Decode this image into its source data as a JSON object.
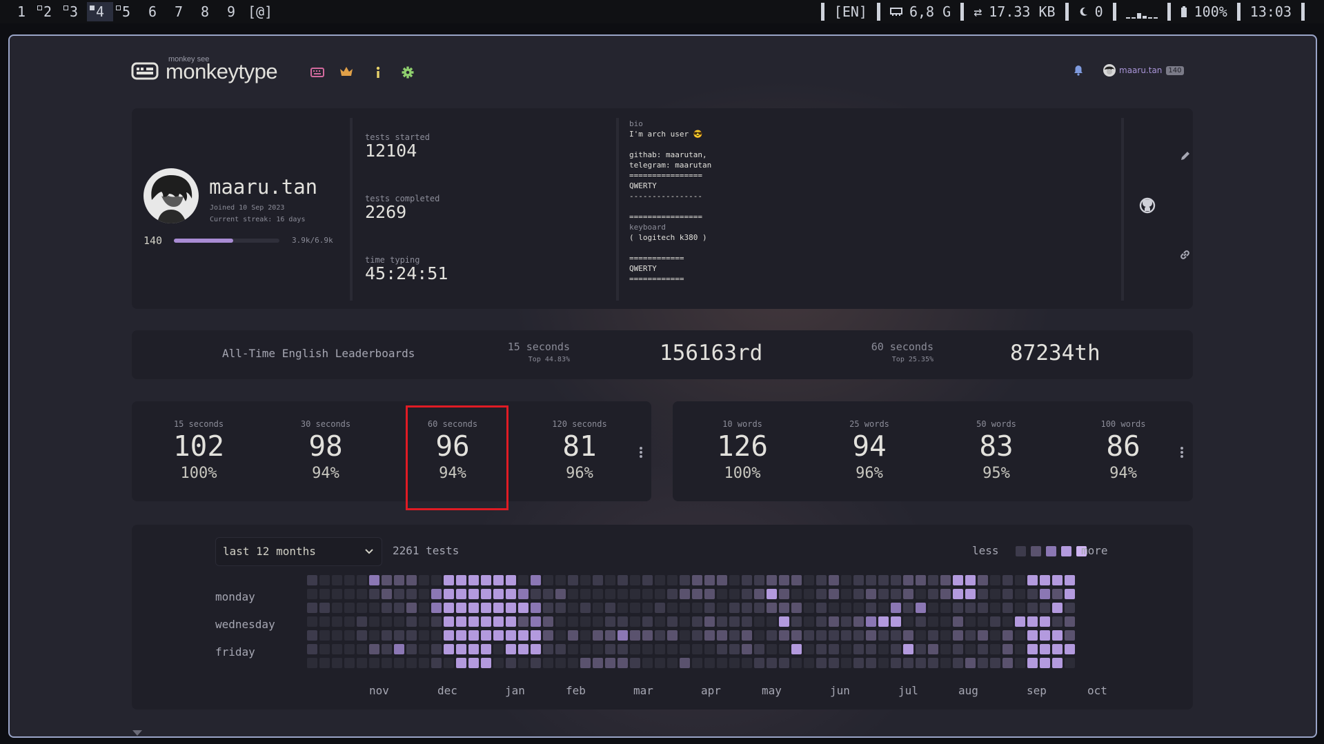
{
  "topbar": {
    "workspaces": [
      {
        "label": "1",
        "occupied": false,
        "active": false
      },
      {
        "label": "2",
        "occupied": true,
        "active": false
      },
      {
        "label": "3",
        "occupied": true,
        "active": false
      },
      {
        "label": "4",
        "occupied": true,
        "active": true
      },
      {
        "label": "5",
        "occupied": true,
        "active": false
      },
      {
        "label": "6",
        "occupied": false,
        "active": false
      },
      {
        "label": "7",
        "occupied": false,
        "active": false
      },
      {
        "label": "8",
        "occupied": false,
        "active": false
      },
      {
        "label": "9",
        "occupied": false,
        "active": false
      },
      {
        "label": "[@]",
        "occupied": false,
        "active": false
      }
    ],
    "layout": "[EN]",
    "memory": "6,8 G",
    "network": "17.33 KB",
    "notifications": "0",
    "battery": "100%",
    "clock": "13:03"
  },
  "header": {
    "logo_top": "monkey see",
    "logo_text": "monkeytype",
    "nav_icons": [
      "keyboard-icon",
      "crown-icon",
      "info-icon",
      "gear-icon"
    ],
    "username": "maaru.tan",
    "level": "140"
  },
  "profile": {
    "name": "maaru.tan",
    "joined": "Joined 10 Sep 2023",
    "streak": "Current streak: 16 days",
    "level": "140",
    "xp": "3.9k/6.9k",
    "xp_progress": 0.565,
    "stats": [
      {
        "label": "tests started",
        "value": "12104"
      },
      {
        "label": "tests completed",
        "value": "2269"
      },
      {
        "label": "time typing",
        "value": "45:24:51"
      }
    ],
    "bio_label": "bio",
    "bio": "I'm arch user 😎\n\ngithab: maarutan,\ntelegram: maarutan\n================\nQWERTY\n----------------\n\n================",
    "keyboard_label": "keyboard",
    "keyboard": "( logitech k380 )\n\n============\nQWERTY\n============"
  },
  "leaderboards": {
    "title": "All-Time English Leaderboards",
    "entries": [
      {
        "mode": "15 seconds",
        "top": "Top 44.83%",
        "rank": "156163rd"
      },
      {
        "mode": "60 seconds",
        "top": "Top 25.35%",
        "rank": "87234th"
      }
    ]
  },
  "time_pbs": [
    {
      "mode": "15 seconds",
      "wpm": "102",
      "acc": "100%"
    },
    {
      "mode": "30 seconds",
      "wpm": "98",
      "acc": "94%"
    },
    {
      "mode": "60 seconds",
      "wpm": "96",
      "acc": "94%"
    },
    {
      "mode": "120 seconds",
      "wpm": "81",
      "acc": "96%"
    }
  ],
  "word_pbs": [
    {
      "mode": "10 words",
      "wpm": "126",
      "acc": "100%"
    },
    {
      "mode": "25 words",
      "wpm": "94",
      "acc": "96%"
    },
    {
      "mode": "50 words",
      "wpm": "83",
      "acc": "95%"
    },
    {
      "mode": "100 words",
      "wpm": "86",
      "acc": "94%"
    }
  ],
  "activity": {
    "range": "last 12 months",
    "total": "2261 tests",
    "less": "less",
    "more": "more",
    "days": [
      "monday",
      "wednesday",
      "friday"
    ],
    "months": [
      "nov",
      "dec",
      "jan",
      "feb",
      "mar",
      "apr",
      "may",
      "jun",
      "jul",
      "aug",
      "sep",
      "oct"
    ],
    "colors": [
      "#2c2c37",
      "#3d3b4c",
      "#5a526e",
      "#8b77b4",
      "#b39ade",
      "#cfb4f2"
    ],
    "grid": [
      [
        1,
        0,
        0,
        0,
        0,
        3,
        2,
        2,
        2,
        0,
        0,
        4,
        4,
        4,
        4,
        4,
        4,
        0,
        3,
        0,
        0,
        1,
        0,
        1,
        0,
        1,
        0,
        1,
        0,
        0,
        1,
        2,
        2,
        2,
        0,
        1,
        1,
        2,
        2,
        2,
        0,
        1,
        2,
        0,
        1,
        1,
        1,
        1,
        2,
        2,
        1,
        2,
        4,
        4,
        2,
        0,
        1,
        0,
        4,
        4,
        4,
        4
      ],
      [
        0,
        0,
        0,
        0,
        0,
        1,
        2,
        1,
        1,
        0,
        3,
        4,
        4,
        4,
        4,
        4,
        4,
        3,
        1,
        1,
        2,
        0,
        0,
        0,
        0,
        0,
        0,
        0,
        0,
        1,
        2,
        2,
        2,
        0,
        0,
        1,
        2,
        4,
        2,
        0,
        0,
        1,
        2,
        0,
        1,
        2,
        1,
        1,
        2,
        0,
        1,
        2,
        4,
        4,
        1,
        0,
        1,
        0,
        1,
        3,
        2,
        4
      ],
      [
        1,
        1,
        0,
        0,
        0,
        0,
        1,
        1,
        2,
        0,
        3,
        4,
        4,
        4,
        4,
        4,
        4,
        4,
        3,
        1,
        1,
        0,
        1,
        0,
        1,
        0,
        0,
        0,
        1,
        0,
        0,
        0,
        1,
        0,
        1,
        1,
        1,
        2,
        2,
        2,
        0,
        1,
        0,
        0,
        0,
        1,
        0,
        3,
        1,
        3,
        0,
        0,
        1,
        1,
        1,
        0,
        1,
        0,
        1,
        1,
        4,
        1
      ],
      [
        0,
        0,
        0,
        0,
        1,
        0,
        0,
        0,
        1,
        0,
        1,
        4,
        4,
        4,
        4,
        4,
        4,
        2,
        3,
        2,
        0,
        0,
        0,
        0,
        1,
        1,
        0,
        1,
        0,
        1,
        0,
        1,
        2,
        1,
        1,
        1,
        0,
        0,
        4,
        1,
        0,
        1,
        2,
        1,
        2,
        3,
        4,
        4,
        0,
        1,
        0,
        0,
        2,
        0,
        0,
        1,
        0,
        4,
        4,
        4,
        1,
        2
      ],
      [
        1,
        0,
        0,
        0,
        1,
        0,
        1,
        1,
        1,
        0,
        0,
        4,
        4,
        4,
        4,
        4,
        4,
        4,
        4,
        2,
        0,
        2,
        0,
        2,
        2,
        3,
        2,
        2,
        1,
        2,
        0,
        1,
        2,
        2,
        1,
        2,
        0,
        1,
        2,
        2,
        1,
        1,
        1,
        1,
        1,
        2,
        1,
        1,
        2,
        0,
        1,
        0,
        2,
        1,
        2,
        0,
        2,
        0,
        4,
        4,
        4,
        2
      ],
      [
        1,
        0,
        0,
        0,
        0,
        2,
        1,
        3,
        1,
        0,
        1,
        4,
        4,
        4,
        4,
        0,
        4,
        4,
        4,
        1,
        1,
        0,
        0,
        0,
        1,
        1,
        0,
        0,
        0,
        0,
        0,
        0,
        0,
        1,
        1,
        2,
        1,
        0,
        0,
        4,
        0,
        1,
        1,
        0,
        1,
        1,
        0,
        1,
        4,
        1,
        2,
        0,
        1,
        0,
        1,
        0,
        2,
        0,
        4,
        4,
        4,
        4
      ],
      [
        0,
        0,
        0,
        0,
        0,
        0,
        0,
        0,
        0,
        0,
        1,
        0,
        4,
        4,
        4,
        0,
        1,
        0,
        1,
        0,
        0,
        0,
        2,
        2,
        2,
        2,
        1,
        0,
        0,
        0,
        2,
        0,
        0,
        0,
        0,
        0,
        1,
        1,
        1,
        0,
        0,
        1,
        1,
        0,
        1,
        1,
        0,
        1,
        1,
        1,
        1,
        0,
        1,
        2,
        1,
        1,
        2,
        0,
        4,
        4,
        4,
        0
      ]
    ]
  }
}
